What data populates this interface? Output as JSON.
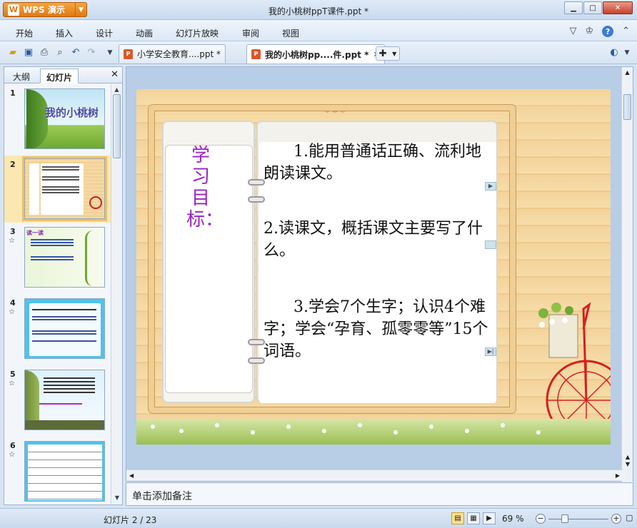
{
  "app": {
    "button_label": "WPS 演示",
    "window_title": "我的小桃树ppT课件.ppt *"
  },
  "menu": [
    "开始",
    "插入",
    "设计",
    "动画",
    "幻灯片放映",
    "审阅",
    "视图"
  ],
  "doc_tabs": [
    {
      "label": "小学安全教育....ppt *",
      "active": false
    },
    {
      "label": "我的小桃树pp....件.ppt *",
      "active": true
    }
  ],
  "left_panel": {
    "tabs": [
      "大纲",
      "幻灯片"
    ],
    "active_tab": "幻灯片",
    "slides": [
      {
        "number": "1",
        "title": "我的小桃树",
        "has_anim": false
      },
      {
        "number": "2",
        "title": "",
        "has_anim": false,
        "selected": true
      },
      {
        "number": "3",
        "title": "读一读",
        "has_anim": true
      },
      {
        "number": "4",
        "title": "",
        "has_anim": true
      },
      {
        "number": "5",
        "title": "",
        "has_anim": true
      },
      {
        "number": "6",
        "title": "",
        "has_anim": true
      }
    ]
  },
  "slide": {
    "side_title": "学习目标：",
    "objective_1": "1.能用普通话正确、流利地朗读课文。",
    "objective_2": "2.读课文，概括课文主要写了什么。",
    "objective_3": "3.学会7个生字；认识4个难字；学会“孕育、孤零零等”15个词语。"
  },
  "notes_placeholder": "单击添加备注",
  "status": {
    "slide_indicator": "幻灯片 2 / 23",
    "zoom": "69 %"
  }
}
